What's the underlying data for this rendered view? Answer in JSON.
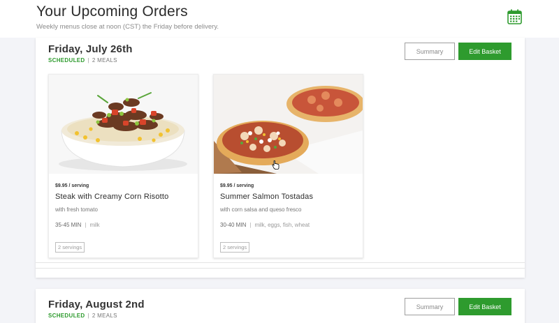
{
  "header": {
    "title": "Your Upcoming Orders",
    "subtitle": "Weekly menus close at noon (CST) the Friday before delivery.",
    "calendar_icon": "calendar-icon"
  },
  "colors": {
    "accent_green": "#2e9b2e",
    "background": "#f3f4f8"
  },
  "orders": [
    {
      "date": "Friday, July 26th",
      "status": "SCHEDULED",
      "separator": "|",
      "meal_count": "2 MEALS",
      "summary_label": "Summary",
      "edit_label": "Edit Basket",
      "meals": [
        {
          "price": "$9.95 / serving",
          "name": "Steak with Creamy Corn Risotto",
          "subtitle": "with fresh tomato",
          "time": "35-45 MIN",
          "separator": "|",
          "allergens": "milk",
          "servings": "2 servings"
        },
        {
          "price": "$9.95 / serving",
          "name": "Summer Salmon Tostadas",
          "subtitle": "with corn salsa and queso fresco",
          "time": "30-40 MIN",
          "separator": "|",
          "allergens": "milk, eggs, fish, wheat",
          "servings": "2 servings"
        }
      ]
    },
    {
      "date": "Friday, August 2nd",
      "status": "SCHEDULED",
      "separator": "|",
      "meal_count": "2 MEALS",
      "summary_label": "Summary",
      "edit_label": "Edit Basket"
    }
  ]
}
